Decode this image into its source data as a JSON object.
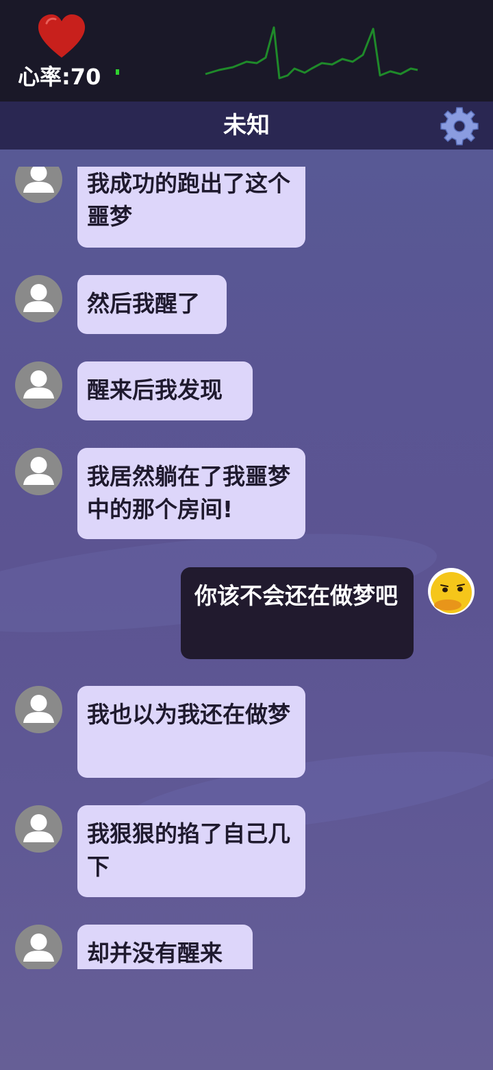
{
  "hud": {
    "heart_rate_label": "心率:70",
    "heart_icon": "heart-icon",
    "ecg_icon": "ecg-waveform",
    "colors": {
      "heart": "#c8201c",
      "ecg": "#1f8a2a",
      "bar": "#1a1828"
    }
  },
  "header": {
    "title": "未知",
    "settings_icon": "gear-icon"
  },
  "messages": [
    {
      "side": "left",
      "text": "我成功的跑出了这个噩梦"
    },
    {
      "side": "left",
      "text": "然后我醒了"
    },
    {
      "side": "left",
      "text": "醒来后我发现"
    },
    {
      "side": "left",
      "text": "我居然躺在了我噩梦中的那个房间!"
    },
    {
      "side": "right",
      "text": "你该不会还在做梦吧"
    },
    {
      "side": "left",
      "text": "我也以为我还在做梦"
    },
    {
      "side": "left",
      "text": "我狠狠的掐了自己几下"
    },
    {
      "side": "left",
      "text": "却并没有醒来"
    }
  ],
  "colors": {
    "left_bubble": "#ddd6fa",
    "right_bubble": "#211a2e",
    "title_bar": "#2a2752"
  }
}
